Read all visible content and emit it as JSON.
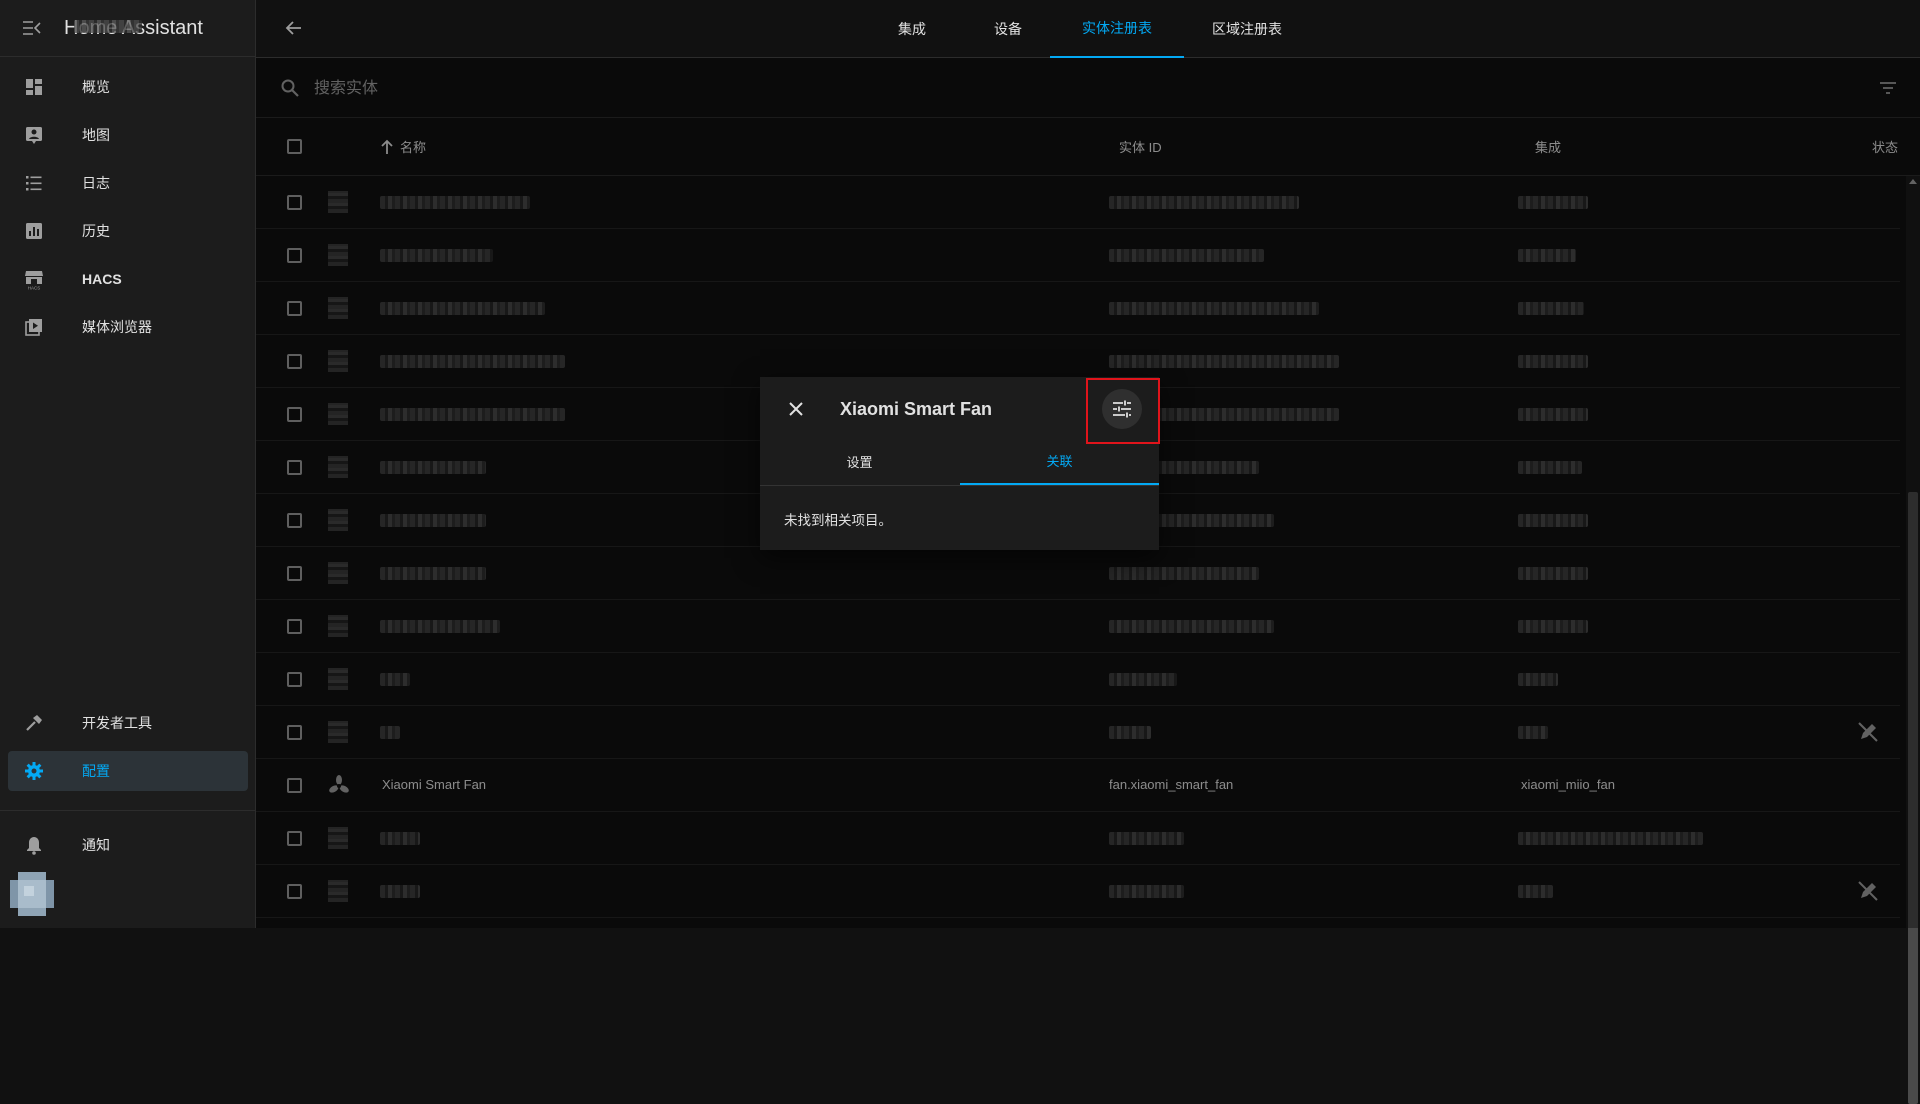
{
  "app": {
    "title": "Home Assistant"
  },
  "sidebar": {
    "items": [
      {
        "label": "概览",
        "icon": "dashboard-icon"
      },
      {
        "label": "地图",
        "icon": "map-icon"
      },
      {
        "label": "日志",
        "icon": "logbook-icon"
      },
      {
        "label": "历史",
        "icon": "history-icon"
      },
      {
        "label": "HACS",
        "icon": "hacs-icon"
      },
      {
        "label": "媒体浏览器",
        "icon": "media-browser-icon"
      },
      {
        "label": "开发者工具",
        "icon": "hammer-icon"
      },
      {
        "label": "配置",
        "icon": "gear-icon",
        "active": true
      },
      {
        "label": "通知",
        "icon": "bell-icon"
      }
    ]
  },
  "tabs": [
    {
      "label": "集成"
    },
    {
      "label": "设备"
    },
    {
      "label": "实体注册表",
      "active": true
    },
    {
      "label": "区域注册表"
    }
  ],
  "search": {
    "placeholder": "搜索实体"
  },
  "table": {
    "columns": [
      "名称",
      "实体 ID",
      "集成",
      "状态"
    ],
    "visible_row": {
      "name": "Xiaomi Smart Fan",
      "entity_id": "fan.xiaomi_smart_fan",
      "integration": "xiaomi_miio_fan",
      "icon": "fan-icon"
    }
  },
  "dialog": {
    "title": "Xiaomi Smart Fan",
    "tabs": [
      {
        "label": "设置"
      },
      {
        "label": "关联",
        "active": true
      }
    ],
    "body": "未找到相关项目。",
    "settings_icon": "tune-icon"
  },
  "colors": {
    "accent": "#03a9f4",
    "highlight": "#e0141b",
    "background": "#111111",
    "sidebar": "#1c1c1c"
  }
}
